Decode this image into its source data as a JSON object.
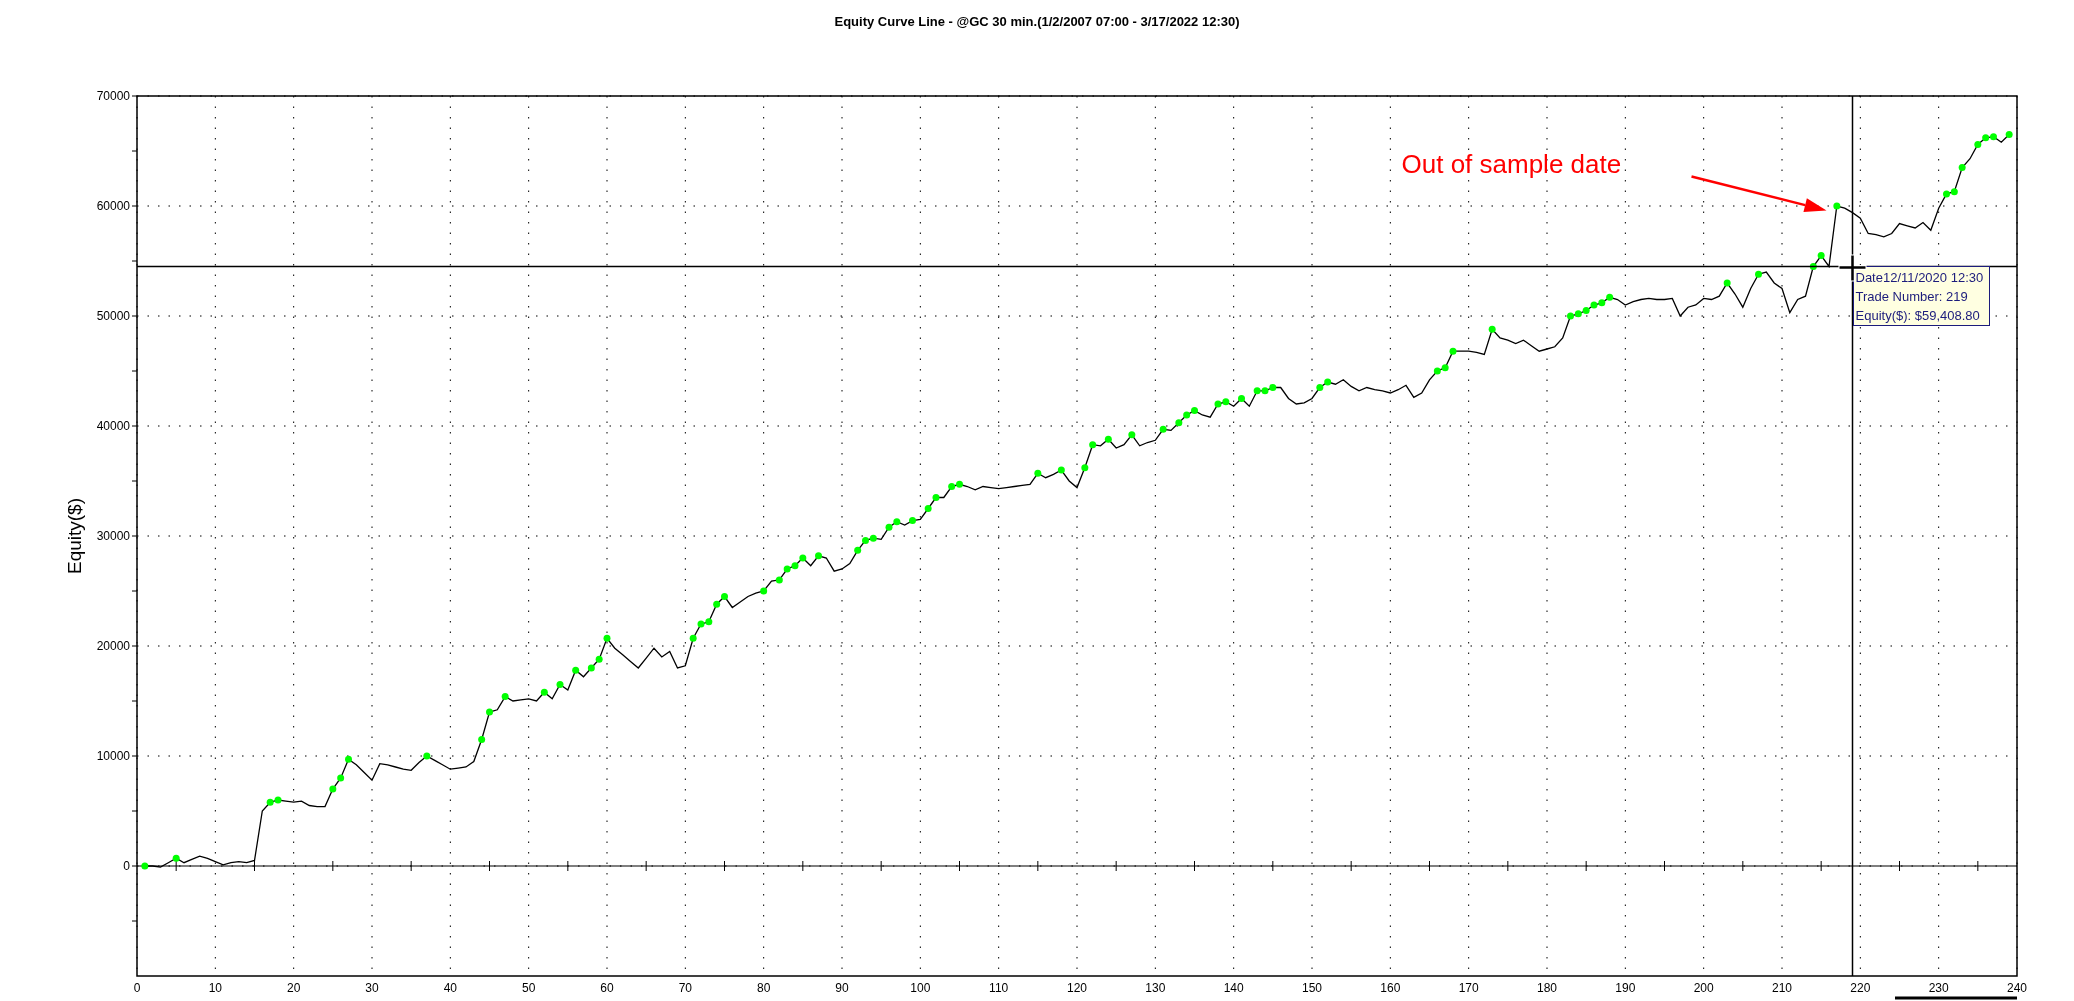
{
  "chart": {
    "chart_data": {
      "type": "line",
      "title": "Equity Curve Line - @GC 30 min.(1/2/2007 07:00 - 3/17/2022 12:30)",
      "ylabel": "Equity($)",
      "xlim": [
        0,
        240
      ],
      "ylim": [
        -10000,
        70000
      ],
      "grid": true,
      "xticks": [
        0,
        10,
        20,
        30,
        40,
        50,
        60,
        70,
        80,
        90,
        100,
        110,
        120,
        130,
        140,
        150,
        160,
        170,
        180,
        190,
        200,
        210,
        220,
        230,
        240
      ],
      "yticks": [
        0,
        10000,
        20000,
        30000,
        40000,
        50000,
        60000,
        70000
      ],
      "x": [
        1,
        2,
        3,
        4,
        5,
        6,
        7,
        8,
        9,
        10,
        11,
        12,
        13,
        14,
        15,
        16,
        17,
        18,
        19,
        20,
        21,
        22,
        23,
        24,
        25,
        26,
        27,
        28,
        29,
        30,
        31,
        32,
        33,
        34,
        35,
        36,
        37,
        38,
        39,
        40,
        41,
        42,
        43,
        44,
        45,
        46,
        47,
        48,
        49,
        50,
        51,
        52,
        53,
        54,
        55,
        56,
        57,
        58,
        59,
        60,
        61,
        62,
        63,
        64,
        65,
        66,
        67,
        68,
        69,
        70,
        71,
        72,
        73,
        74,
        75,
        76,
        77,
        78,
        79,
        80,
        81,
        82,
        83,
        84,
        85,
        86,
        87,
        88,
        89,
        90,
        91,
        92,
        93,
        94,
        95,
        96,
        97,
        98,
        99,
        100,
        101,
        102,
        103,
        104,
        105,
        106,
        107,
        108,
        109,
        110,
        111,
        112,
        113,
        114,
        115,
        116,
        117,
        118,
        119,
        120,
        121,
        122,
        123,
        124,
        125,
        126,
        127,
        128,
        129,
        130,
        131,
        132,
        133,
        134,
        135,
        136,
        137,
        138,
        139,
        140,
        141,
        142,
        143,
        144,
        145,
        146,
        147,
        148,
        149,
        150,
        151,
        152,
        153,
        154,
        155,
        156,
        157,
        158,
        159,
        160,
        161,
        162,
        163,
        164,
        165,
        166,
        167,
        168,
        169,
        170,
        171,
        172,
        173,
        174,
        175,
        176,
        177,
        178,
        179,
        180,
        181,
        182,
        183,
        184,
        185,
        186,
        187,
        188,
        189,
        190,
        191,
        192,
        193,
        194,
        195,
        196,
        197,
        198,
        199,
        200,
        201,
        202,
        203,
        204,
        205,
        206,
        207,
        208,
        209,
        210,
        211,
        212,
        213,
        214,
        215,
        216,
        217,
        218,
        219,
        220,
        221,
        222,
        223,
        224,
        225,
        226,
        227,
        228,
        229,
        230,
        231,
        232,
        233,
        234,
        235,
        236,
        237,
        238,
        239
      ],
      "series": [
        {
          "color": "#000000",
          "values": [
            0,
            0,
            -100,
            300,
            700,
            300,
            600,
            900,
            700,
            400,
            100,
            300,
            400,
            300,
            500,
            5000,
            5800,
            6000,
            5900,
            5800,
            5900,
            5500,
            5400,
            5400,
            7000,
            8000,
            9700,
            9200,
            8500,
            7800,
            9300,
            9200,
            9000,
            8800,
            8700,
            9400,
            10000,
            9600,
            9200,
            8800,
            8900,
            9000,
            9500,
            11500,
            14000,
            14200,
            15400,
            15000,
            15100,
            15200,
            15000,
            15800,
            15200,
            16500,
            16000,
            17800,
            17200,
            18000,
            18800,
            20700,
            19800,
            19200,
            18600,
            18000,
            18900,
            19800,
            19000,
            19500,
            18000,
            18200,
            20700,
            22000,
            22200,
            23800,
            24500,
            23500,
            24000,
            24500,
            24800,
            25000,
            25900,
            26000,
            27000,
            27300,
            28000,
            27300,
            28200,
            28000,
            26800,
            27000,
            27500,
            28700,
            29600,
            29800,
            29700,
            30800,
            31300,
            31000,
            31400,
            31500,
            32500,
            33500,
            33500,
            34500,
            34700,
            34500,
            34200,
            34500,
            34400,
            34300,
            34400,
            34500,
            34600,
            34700,
            35700,
            35300,
            35600,
            36000,
            35000,
            34400,
            36200,
            38300,
            38200,
            38800,
            38000,
            38300,
            39200,
            38200,
            38500,
            38700,
            39700,
            39600,
            40300,
            41000,
            41400,
            41000,
            40800,
            42000,
            42200,
            41800,
            42500,
            41800,
            43200,
            43200,
            43500,
            43500,
            42500,
            42000,
            42100,
            42500,
            43500,
            44000,
            43800,
            44200,
            43600,
            43200,
            43500,
            43300,
            43200,
            43000,
            43300,
            43700,
            42600,
            43000,
            44200,
            45000,
            45300,
            46800,
            46800,
            46800,
            46700,
            46500,
            48800,
            48000,
            47800,
            47500,
            47800,
            47300,
            46800,
            47000,
            47200,
            48000,
            50000,
            50200,
            50500,
            51000,
            51200,
            51700,
            51500,
            51000,
            51300,
            51500,
            51600,
            51500,
            51500,
            51600,
            50000,
            50800,
            51000,
            51600,
            51500,
            51800,
            53000,
            52000,
            50800,
            52500,
            53800,
            54000,
            53000,
            52500,
            50300,
            51500,
            51800,
            54500,
            55500,
            54500,
            60000,
            59800,
            59400,
            58900,
            57500,
            57400,
            57200,
            57500,
            58400,
            58200,
            58000,
            58500,
            57800,
            59800,
            61100,
            61300,
            63500,
            64300,
            65600,
            66200,
            66300,
            65800,
            66500
          ]
        },
        {
          "type": "scatter",
          "color": "#00ff00",
          "values": [
            0,
            null,
            null,
            null,
            700,
            null,
            null,
            null,
            null,
            null,
            null,
            null,
            null,
            null,
            null,
            null,
            5800,
            6000,
            null,
            null,
            null,
            null,
            null,
            null,
            7000,
            8000,
            9700,
            null,
            null,
            null,
            null,
            null,
            null,
            null,
            null,
            null,
            10000,
            null,
            null,
            null,
            null,
            null,
            null,
            11500,
            14000,
            null,
            15400,
            null,
            null,
            null,
            null,
            15800,
            null,
            16500,
            null,
            17800,
            null,
            18000,
            18800,
            20700,
            null,
            null,
            null,
            null,
            null,
            null,
            null,
            null,
            null,
            null,
            20700,
            22000,
            22200,
            23800,
            24500,
            null,
            null,
            null,
            null,
            25000,
            null,
            26000,
            27000,
            27300,
            28000,
            null,
            28200,
            null,
            null,
            null,
            null,
            28700,
            29600,
            29800,
            null,
            30800,
            31300,
            null,
            31400,
            null,
            32500,
            33500,
            null,
            34500,
            34700,
            null,
            null,
            null,
            null,
            null,
            null,
            null,
            null,
            null,
            35700,
            null,
            null,
            36000,
            null,
            null,
            36200,
            38300,
            null,
            38800,
            null,
            null,
            39200,
            null,
            null,
            null,
            39700,
            null,
            40300,
            41000,
            41400,
            null,
            null,
            42000,
            42200,
            null,
            42500,
            null,
            43200,
            43200,
            43500,
            null,
            null,
            null,
            null,
            null,
            43500,
            44000,
            null,
            null,
            null,
            null,
            null,
            null,
            null,
            null,
            null,
            null,
            null,
            null,
            null,
            45000,
            45300,
            46800,
            null,
            null,
            null,
            null,
            48800,
            null,
            null,
            null,
            null,
            null,
            null,
            null,
            null,
            null,
            50000,
            50200,
            50500,
            51000,
            51200,
            51700,
            null,
            null,
            null,
            null,
            null,
            null,
            null,
            null,
            null,
            null,
            null,
            null,
            null,
            null,
            53000,
            null,
            null,
            null,
            53800,
            null,
            null,
            null,
            null,
            null,
            null,
            54500,
            55500,
            null,
            60000,
            null,
            null,
            null,
            null,
            null,
            null,
            null,
            null,
            null,
            null,
            null,
            null,
            null,
            61100,
            61300,
            63500,
            null,
            65600,
            66200,
            66300,
            null,
            66500
          ]
        }
      ],
      "ref_lines": [
        {
          "axis": "x",
          "value": 219
        },
        {
          "axis": "y",
          "value": 54500
        }
      ],
      "annotations": [
        "Out of sample date"
      ]
    },
    "tooltip": {
      "lines": [
        "Date12/11/2020 12:30",
        "Trade Number: 219",
        "Equity($): $59,408.80"
      ]
    }
  }
}
